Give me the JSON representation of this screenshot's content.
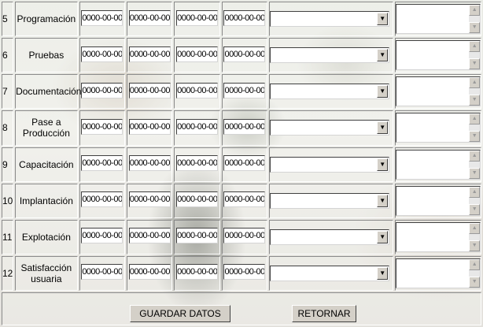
{
  "rows": [
    {
      "num": "5",
      "stage": "Programación",
      "dates": [
        "0000-00-00",
        "0000-00-00",
        "0000-00-00",
        "0000-00-00"
      ],
      "select_value": "",
      "note": ""
    },
    {
      "num": "6",
      "stage": "Pruebas",
      "dates": [
        "0000-00-00",
        "0000-00-00",
        "0000-00-00",
        "0000-00-00"
      ],
      "select_value": "",
      "note": ""
    },
    {
      "num": "7",
      "stage": "Documentación",
      "dates": [
        "0000-00-00",
        "0000-00-00",
        "0000-00-00",
        "0000-00-00"
      ],
      "select_value": "",
      "note": ""
    },
    {
      "num": "8",
      "stage": "Pase a Producción",
      "dates": [
        "0000-00-00",
        "0000-00-00",
        "0000-00-00",
        "0000-00-00"
      ],
      "select_value": "",
      "note": ""
    },
    {
      "num": "9",
      "stage": "Capacitación",
      "dates": [
        "0000-00-00",
        "0000-00-00",
        "0000-00-00",
        "0000-00-00"
      ],
      "select_value": "",
      "note": ""
    },
    {
      "num": "10",
      "stage": "Implantación",
      "dates": [
        "0000-00-00",
        "0000-00-00",
        "0000-00-00",
        "0000-00-00"
      ],
      "select_value": "",
      "note": ""
    },
    {
      "num": "11",
      "stage": "Explotación",
      "dates": [
        "0000-00-00",
        "0000-00-00",
        "0000-00-00",
        "0000-00-00"
      ],
      "select_value": "",
      "note": ""
    },
    {
      "num": "12",
      "stage": "Satisfacción usuaria",
      "dates": [
        "0000-00-00",
        "0000-00-00",
        "0000-00-00",
        "0000-00-00"
      ],
      "select_value": "",
      "note": ""
    }
  ],
  "icons": {
    "select_arrow": "triangle-down-icon",
    "scroll_up": "triangle-up-icon",
    "scroll_down": "triangle-down-icon"
  },
  "buttons": {
    "save_label": "GUARDAR DATOS",
    "back_label": "RETORNAR"
  }
}
